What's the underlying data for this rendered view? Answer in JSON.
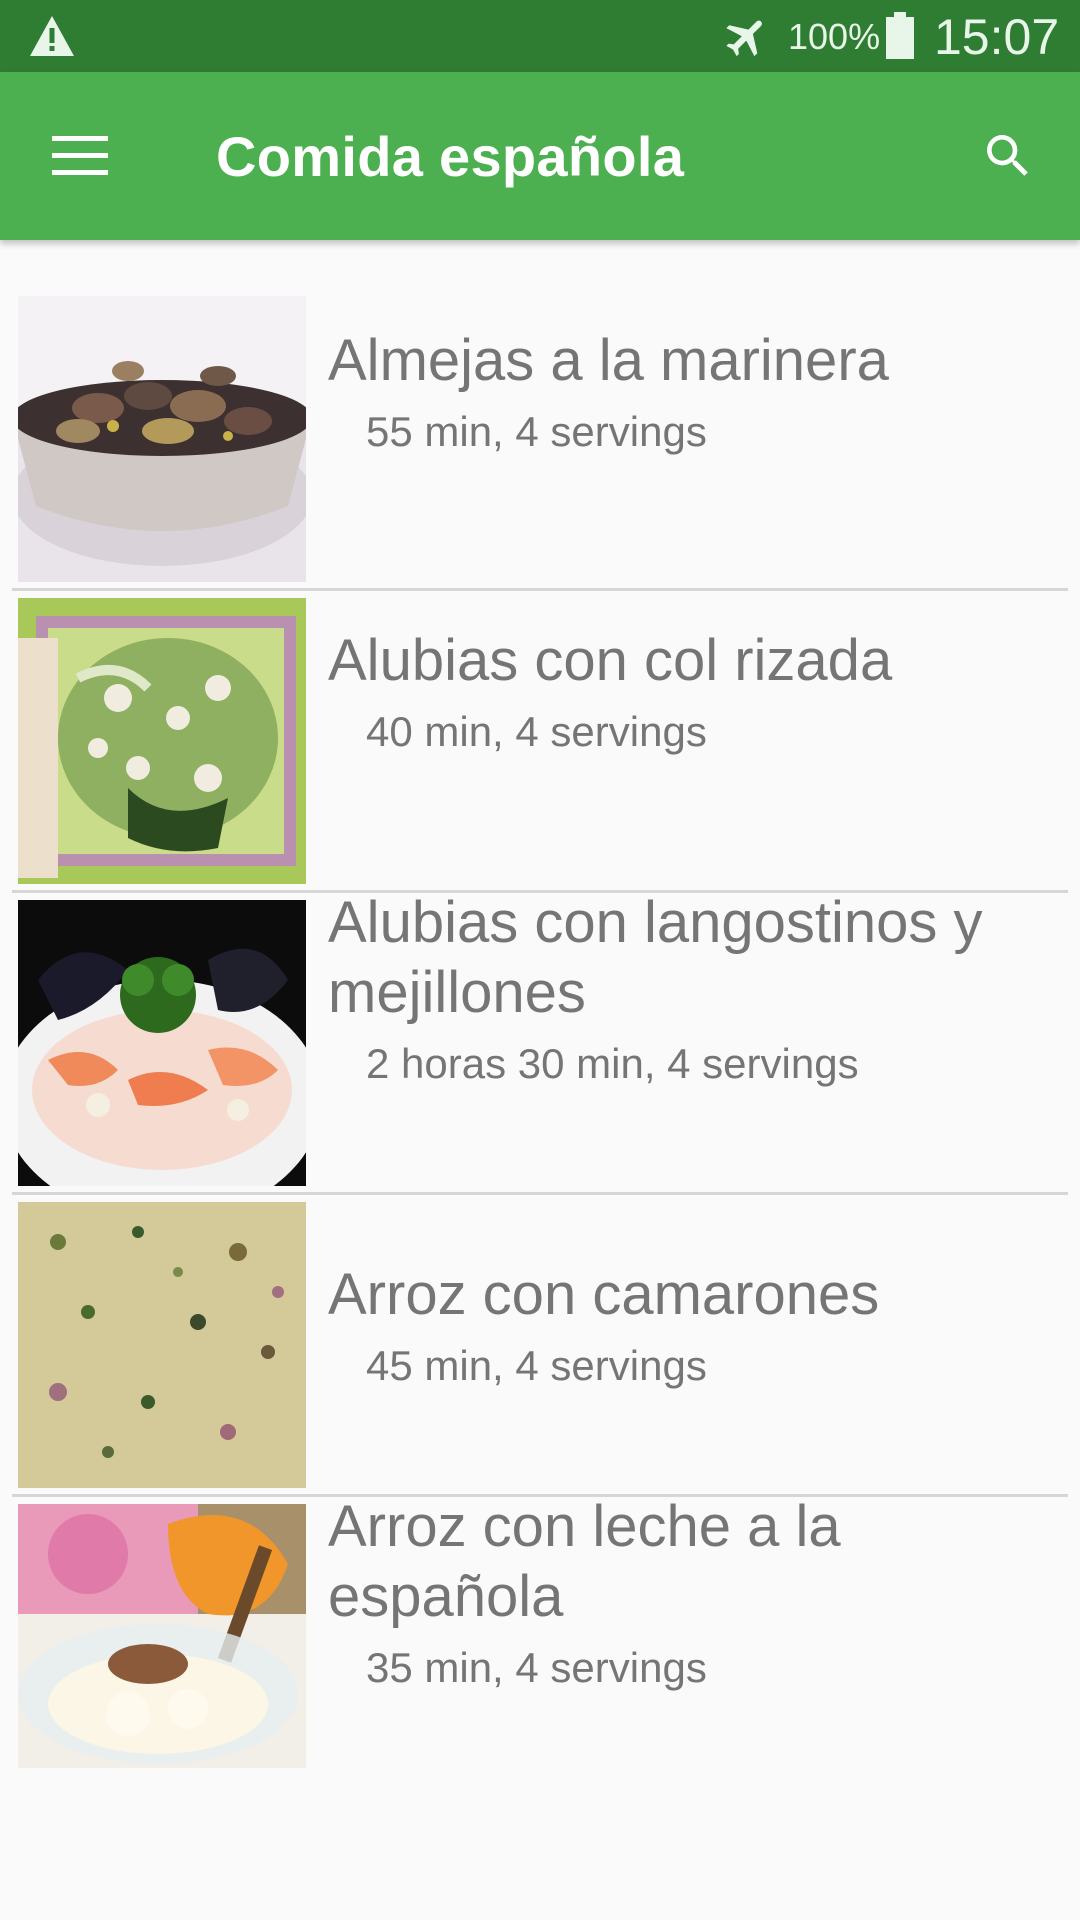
{
  "status_bar": {
    "battery_percent": "100%",
    "time": "15:07",
    "icons": [
      "warning-icon",
      "airplane-mode-icon",
      "battery-icon"
    ]
  },
  "app_bar": {
    "title": "Comida española",
    "icons": [
      "menu-icon",
      "search-icon"
    ],
    "color": "#4caf50",
    "status_color": "#2f7d32"
  },
  "recipes": [
    {
      "name": "Almejas a la marinera",
      "meta": "55 min, 4 servings"
    },
    {
      "name": "Alubias con col rizada",
      "meta": "40 min, 4 servings"
    },
    {
      "name": "Alubias con langostinos y mejillones",
      "meta": "2 horas 30 min, 4 servings"
    },
    {
      "name": "Arroz con camarones",
      "meta": "45 min, 4 servings"
    },
    {
      "name": "Arroz con leche a la española",
      "meta": "35 min, 4 servings"
    }
  ]
}
